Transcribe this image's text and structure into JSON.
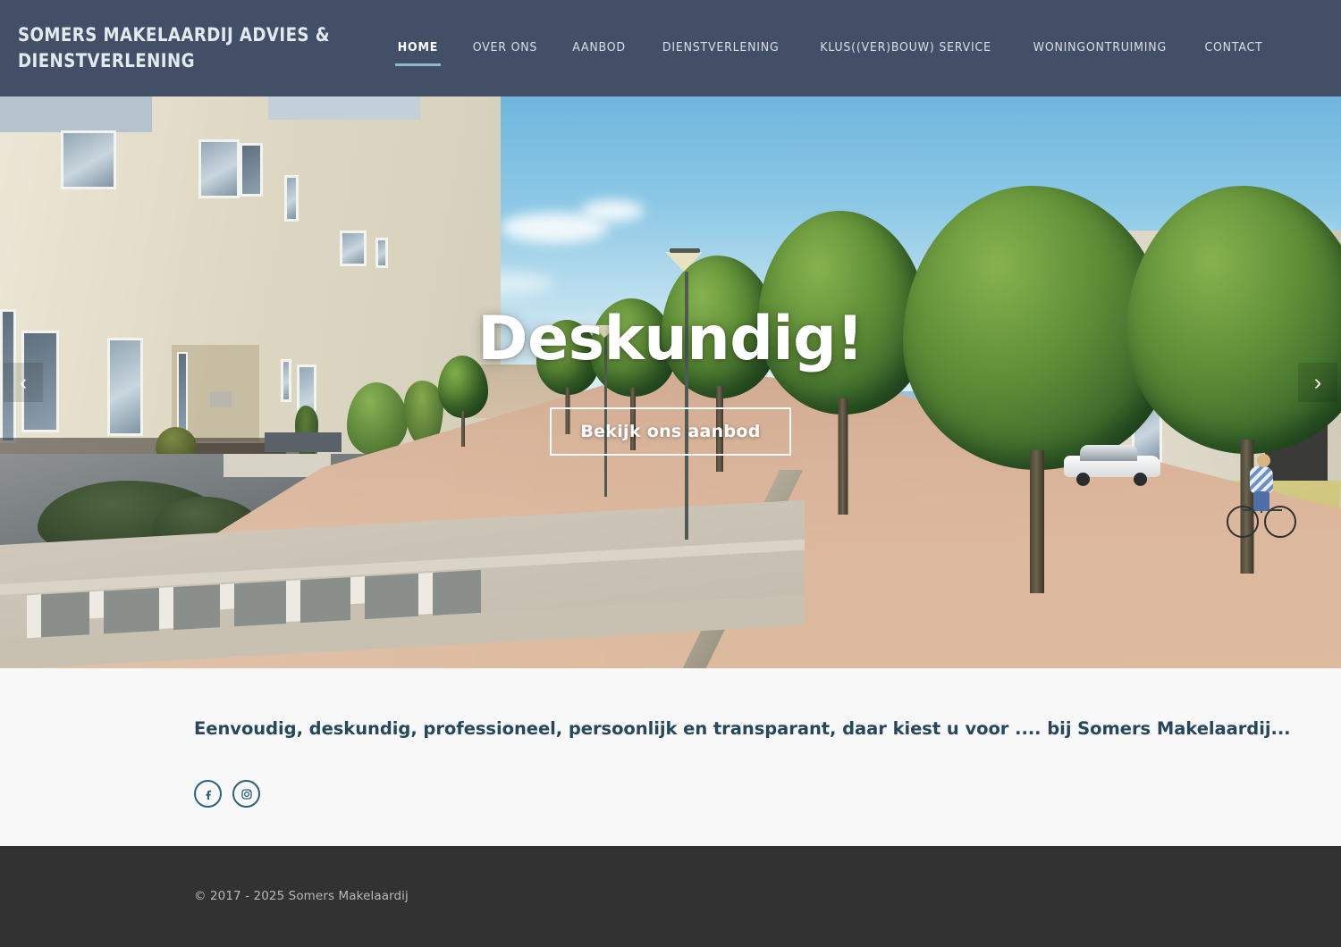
{
  "header": {
    "brand": "Somers Makelaardij Advies & Dienstverlening",
    "background_color": "#434e67",
    "accent_color": "#8fb8cd",
    "nav": [
      {
        "label": "Home",
        "active": true
      },
      {
        "label": "Over ons",
        "active": false
      },
      {
        "label": "Aanbod",
        "active": false
      },
      {
        "label": "Dienstverlening",
        "active": false
      },
      {
        "label": "Klus((ver)bouw) service",
        "active": false
      },
      {
        "label": "Woningontruiming",
        "active": false
      },
      {
        "label": "Contact",
        "active": false
      }
    ]
  },
  "hero": {
    "title": "Deskundig!",
    "button_label": "Bekijk ons aanbod",
    "prev_arrow": "‹",
    "next_arrow": "›",
    "image_description": "Zonnige Nederlandse woonstraat met lichte baksteenwoningen, bomen, geparkeerde auto en fietser"
  },
  "main": {
    "tagline": "Eenvoudig, deskundig, professioneel, persoonlijk en transparant, daar kiest u voor ....  bij Somers Makelaardij...",
    "tagline_color": "#27475c",
    "socials": [
      {
        "name": "facebook",
        "glyph": "f"
      },
      {
        "name": "instagram",
        "glyph": ""
      }
    ],
    "social_color": "#2e6277"
  },
  "footer": {
    "copyright": "© 2017 - 2025 Somers Makelaardij",
    "background_color": "#323232",
    "text_color": "#b9b9b4"
  }
}
